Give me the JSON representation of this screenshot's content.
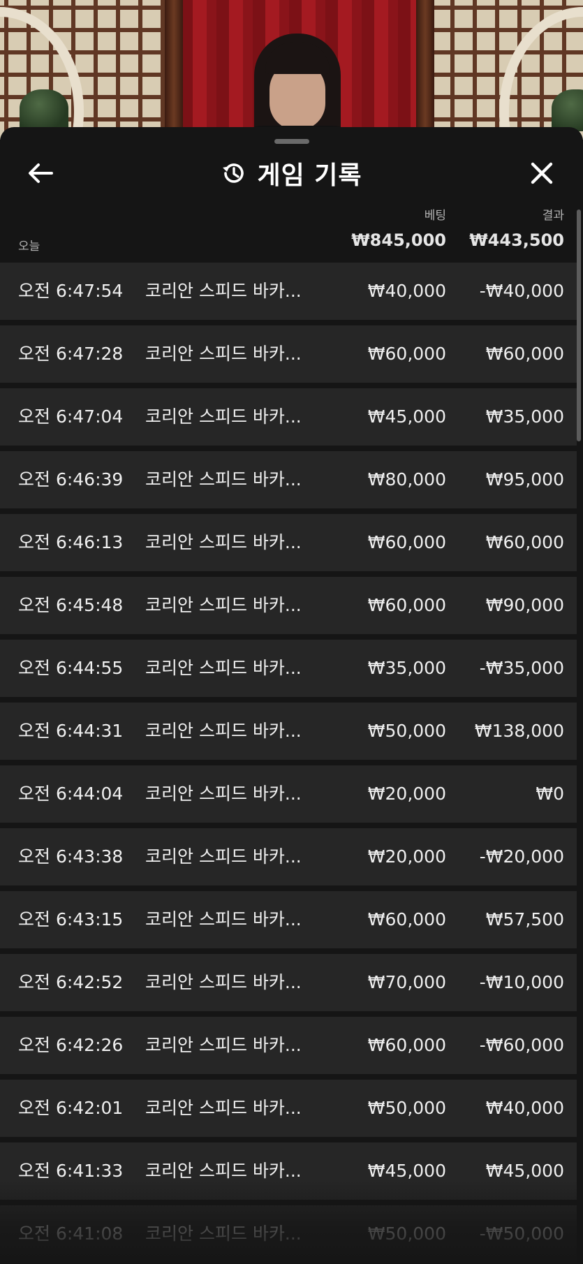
{
  "header": {
    "title": "게임 기록",
    "back_icon": "arrow-left-icon",
    "history_icon": "history-clock-icon",
    "close_icon": "close-icon"
  },
  "columns": {
    "bet_label": "베팅",
    "result_label": "결과"
  },
  "summary": {
    "day_label": "오늘",
    "total_bet": "₩845,000",
    "total_result": "₩443,500"
  },
  "rows": [
    {
      "time": "오전 6:47:54",
      "game": "코리안 스피드 바카...",
      "bet": "₩40,000",
      "result": "-₩40,000"
    },
    {
      "time": "오전 6:47:28",
      "game": "코리안 스피드 바카...",
      "bet": "₩60,000",
      "result": "₩60,000"
    },
    {
      "time": "오전 6:47:04",
      "game": "코리안 스피드 바카...",
      "bet": "₩45,000",
      "result": "₩35,000"
    },
    {
      "time": "오전 6:46:39",
      "game": "코리안 스피드 바카...",
      "bet": "₩80,000",
      "result": "₩95,000"
    },
    {
      "time": "오전 6:46:13",
      "game": "코리안 스피드 바카...",
      "bet": "₩60,000",
      "result": "₩60,000"
    },
    {
      "time": "오전 6:45:48",
      "game": "코리안 스피드 바카...",
      "bet": "₩60,000",
      "result": "₩90,000"
    },
    {
      "time": "오전 6:44:55",
      "game": "코리안 스피드 바카...",
      "bet": "₩35,000",
      "result": "-₩35,000"
    },
    {
      "time": "오전 6:44:31",
      "game": "코리안 스피드 바카...",
      "bet": "₩50,000",
      "result": "₩138,000"
    },
    {
      "time": "오전 6:44:04",
      "game": "코리안 스피드 바카...",
      "bet": "₩20,000",
      "result": "₩0"
    },
    {
      "time": "오전 6:43:38",
      "game": "코리안 스피드 바카...",
      "bet": "₩20,000",
      "result": "-₩20,000"
    },
    {
      "time": "오전 6:43:15",
      "game": "코리안 스피드 바카...",
      "bet": "₩60,000",
      "result": "₩57,500"
    },
    {
      "time": "오전 6:42:52",
      "game": "코리안 스피드 바카...",
      "bet": "₩70,000",
      "result": "-₩10,000"
    },
    {
      "time": "오전 6:42:26",
      "game": "코리안 스피드 바카...",
      "bet": "₩60,000",
      "result": "-₩60,000"
    },
    {
      "time": "오전 6:42:01",
      "game": "코리안 스피드 바카...",
      "bet": "₩50,000",
      "result": "₩40,000"
    },
    {
      "time": "오전 6:41:33",
      "game": "코리안 스피드 바카...",
      "bet": "₩45,000",
      "result": "₩45,000"
    },
    {
      "time": "오전 6:41:08",
      "game": "코리안 스피드 바카...",
      "bet": "₩50,000",
      "result": "-₩50,000"
    }
  ],
  "colors": {
    "sheet_background": "#151515",
    "row_background": "#262626",
    "text_primary": "#f0f0f0",
    "text_secondary": "#b3b3b3",
    "curtain_red": "#a41a21"
  }
}
